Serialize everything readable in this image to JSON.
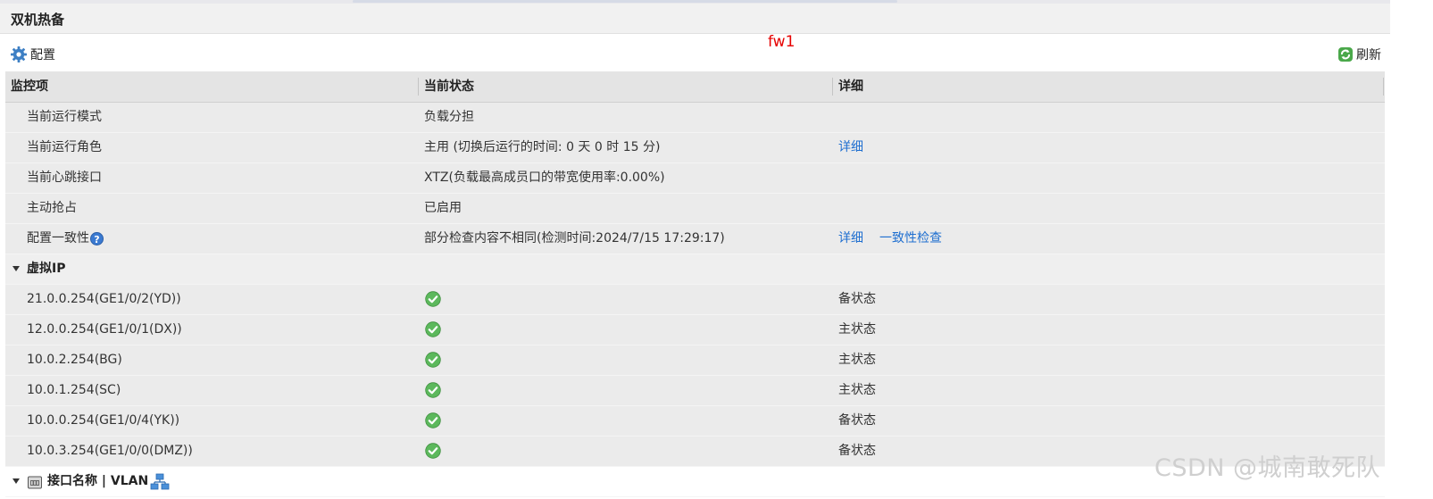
{
  "panel": {
    "title": "双机热备"
  },
  "toolbar": {
    "config_label": "配置",
    "config_icon": "gear-icon",
    "device_name": "fw1",
    "refresh_label": "刷新",
    "refresh_icon": "refresh-icon"
  },
  "table": {
    "columns": [
      "监控项",
      "当前状态",
      "详细"
    ],
    "status_rows": [
      {
        "item": "当前运行模式",
        "status": "负载分担"
      },
      {
        "item": "当前运行角色",
        "status": "主用 (切换后运行的时间: 0 天 0 时 15 分)",
        "detail": "详细"
      },
      {
        "item": "当前心跳接口",
        "status": "XTZ(负载最高成员口的带宽使用率:0.00%)"
      },
      {
        "item": "主动抢占",
        "status": "已启用"
      },
      {
        "item": "配置一致性",
        "help": "?",
        "status": "部分检查内容不相同(检测时间:2024/7/15 17:29:17)",
        "detail": "详细",
        "detail2": "一致性检查"
      }
    ],
    "vip_group": {
      "label": "虚拟IP",
      "rows": [
        {
          "ip": "21.0.0.254(GE1/0/2(YD))",
          "state": "备状态",
          "icon": "check-circle-icon"
        },
        {
          "ip": "12.0.0.254(GE1/0/1(DX))",
          "state": "主状态",
          "icon": "check-circle-icon"
        },
        {
          "ip": "10.0.2.254(BG)",
          "state": "主状态",
          "icon": "check-circle-icon"
        },
        {
          "ip": "10.0.1.254(SC)",
          "state": "主状态",
          "icon": "check-circle-icon"
        },
        {
          "ip": "10.0.0.254(GE1/0/4(YK))",
          "state": "备状态",
          "icon": "check-circle-icon"
        },
        {
          "ip": "10.0.3.254(GE1/0/0(DMZ))",
          "state": "备状态",
          "icon": "check-circle-icon"
        }
      ]
    },
    "interface_group": {
      "label": "接口名称 | VLAN"
    }
  },
  "watermark": "CSDN @城南敢死队",
  "colors": {
    "link": "#1f6fd0",
    "device_name": "#e60000",
    "ok": "#5cb85c"
  }
}
